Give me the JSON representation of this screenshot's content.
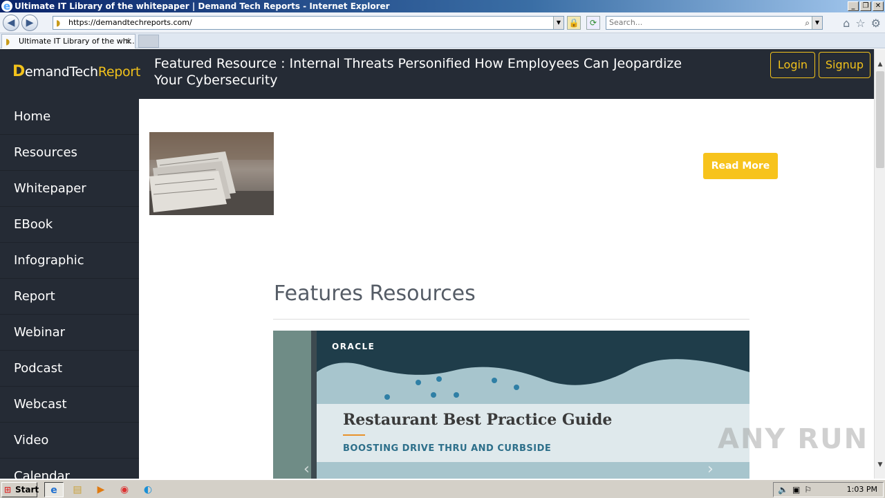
{
  "window": {
    "title": "Ultimate IT Library of the whitepaper | Demand Tech Reports - Internet Explorer",
    "minimize": "_",
    "restore": "❐",
    "close": "✕"
  },
  "browser": {
    "url": "https://demandtechreports.com/",
    "search_placeholder": "Search...",
    "back_glyph": "◀",
    "forward_glyph": "▶",
    "tabs": [
      {
        "label": "Ultimate IT Library of the whi..."
      }
    ],
    "tab_close": "✕",
    "icons": {
      "home": "⌂",
      "favorites": "☆",
      "tools": "⚙",
      "lock": "🔒",
      "refresh": "⟳",
      "search": "⌕",
      "dropdown": "▼"
    }
  },
  "site": {
    "logo": {
      "mark": "D",
      "text": "emandTech",
      "accent": "Report"
    },
    "featured_text": "Featured Resource : Internal Threats Personified How Employees Can Jeopardize Your Cybersecurity",
    "login_label": "Login",
    "signup_label": "Signup",
    "nav": [
      {
        "label": "Home"
      },
      {
        "label": "Resources"
      },
      {
        "label": "Whitepaper"
      },
      {
        "label": "EBook"
      },
      {
        "label": "Infographic"
      },
      {
        "label": "Report"
      },
      {
        "label": "Webinar"
      },
      {
        "label": "Podcast"
      },
      {
        "label": "Webcast"
      },
      {
        "label": "Video"
      },
      {
        "label": "Calendar"
      }
    ],
    "read_more_label": "Read More",
    "section_title": "Features Resources",
    "banner": {
      "brand": "ORACLE",
      "heading": "Restaurant Best Practice Guide",
      "subheading": "BOOSTING DRIVE THRU AND CURBSIDE",
      "prev": "‹",
      "next": "›"
    },
    "watermark": "ANY RUN"
  },
  "colors": {
    "header_bg": "#252b35",
    "accent": "#f2c21b",
    "read_more_bg": "#f7c31c"
  },
  "taskbar": {
    "start_label": "Start",
    "clock": "1:03 PM"
  }
}
